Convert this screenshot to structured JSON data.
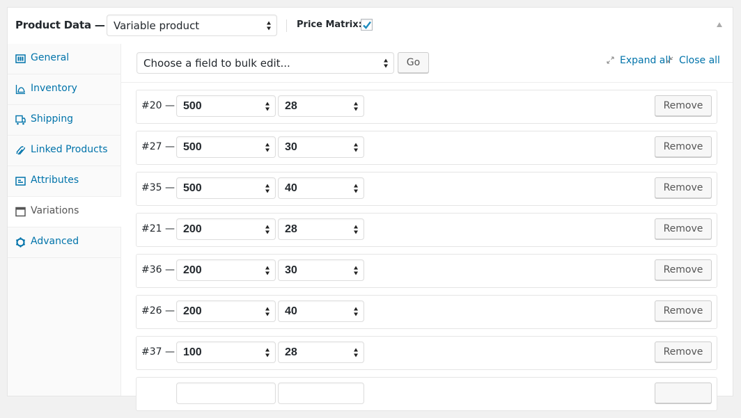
{
  "header": {
    "title": "Product Data —",
    "product_type": "Variable product",
    "price_matrix_label": "Price Matrix:",
    "price_matrix_checked": true
  },
  "sidebar": {
    "items": [
      {
        "label": "General",
        "icon": "general-icon",
        "active": false
      },
      {
        "label": "Inventory",
        "icon": "inventory-icon",
        "active": false
      },
      {
        "label": "Shipping",
        "icon": "shipping-icon",
        "active": false
      },
      {
        "label": "Linked Products",
        "icon": "link-icon",
        "active": false
      },
      {
        "label": "Attributes",
        "icon": "attributes-icon",
        "active": false
      },
      {
        "label": "Variations",
        "icon": "variations-icon",
        "active": true
      },
      {
        "label": "Advanced",
        "icon": "gear-icon",
        "active": false
      }
    ]
  },
  "toolbar": {
    "bulk_edit_placeholder": "Choose a field to bulk edit...",
    "go_label": "Go",
    "expand_all_label": "Expand all",
    "close_all_label": "Close all"
  },
  "variations": [
    {
      "id": "#20 —",
      "attr1": "500",
      "attr2": "28",
      "remove_label": "Remove"
    },
    {
      "id": "#27 —",
      "attr1": "500",
      "attr2": "30",
      "remove_label": "Remove"
    },
    {
      "id": "#35 —",
      "attr1": "500",
      "attr2": "40",
      "remove_label": "Remove"
    },
    {
      "id": "#21 —",
      "attr1": "200",
      "attr2": "28",
      "remove_label": "Remove"
    },
    {
      "id": "#36 —",
      "attr1": "200",
      "attr2": "30",
      "remove_label": "Remove"
    },
    {
      "id": "#26 —",
      "attr1": "200",
      "attr2": "40",
      "remove_label": "Remove"
    },
    {
      "id": "#37 —",
      "attr1": "100",
      "attr2": "28",
      "remove_label": "Remove"
    },
    {
      "id": "",
      "attr1": "",
      "attr2": "",
      "remove_label": ""
    }
  ],
  "colors": {
    "link": "#0073aa",
    "check": "#1e8cbe"
  }
}
